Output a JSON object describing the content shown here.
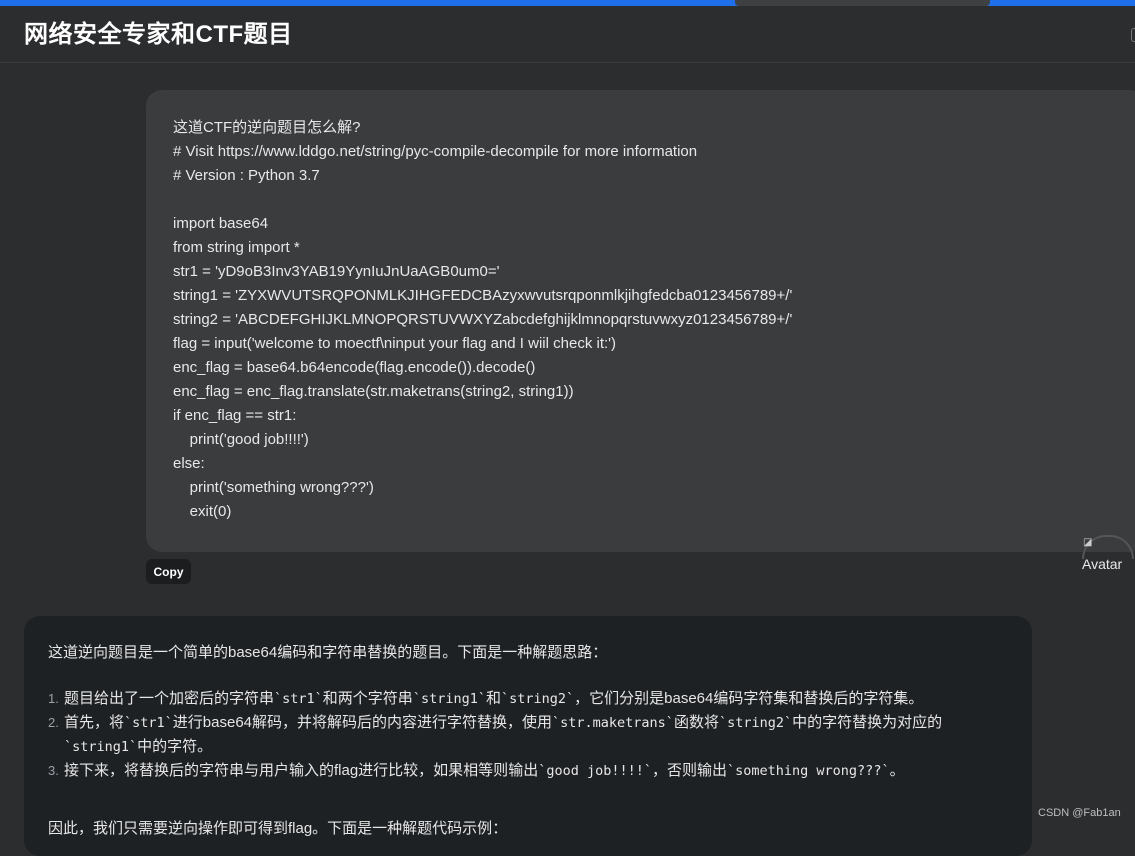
{
  "header": {
    "title": "网络安全专家和CTF题目"
  },
  "user_message": {
    "text": "这道CTF的逆向题目怎么解?\n# Visit https://www.lddgo.net/string/pyc-compile-decompile for more information\n# Version : Python 3.7\n\nimport base64\nfrom string import *\nstr1 = 'yD9oB3Inv3YAB19YynIuJnUaAGB0um0='\nstring1 = 'ZYXWVUTSRQPONMLKJIHGFEDCBAzyxwvutsrqponmlkjihgfedcba0123456789+/'\nstring2 = 'ABCDEFGHIJKLMNOPQRSTUVWXYZabcdefghijklmnopqrstuvwxyz0123456789+/'\nflag = input('welcome to moectf\\ninput your flag and I wiil check it:')\nenc_flag = base64.b64encode(flag.encode()).decode()\nenc_flag = enc_flag.translate(str.maketrans(string2, string1))\nif enc_flag == str1:\n    print('good job!!!!')\nelse:\n    print('something wrong???')\n    exit(0)",
    "copy_label": "Copy",
    "avatar_label": "Avatar"
  },
  "ai_message": {
    "intro": "这道逆向题目是一个简单的base64编码和字符串替换的题目。下面是一种解题思路：",
    "steps": [
      {
        "num": "1.",
        "text": "题目给出了一个加密后的字符串`str1`和两个字符串`string1`和`string2`，它们分别是base64编码字符集和替换后的字符集。"
      },
      {
        "num": "2.",
        "text": "首先，将`str1`进行base64解码，并将解码后的内容进行字符替换，使用`str.maketrans`函数将`string2`中的字符替换为对应的`string1`中的字符。"
      },
      {
        "num": "3.",
        "text": "接下来，将替换后的字符串与用户输入的flag进行比较，如果相等则输出`good job!!!!`，否则输出`something wrong???`。"
      }
    ],
    "outro": "因此，我们只需要逆向操作即可得到flag。下面是一种解题代码示例："
  },
  "watermark": "CSDN @Fab1an"
}
